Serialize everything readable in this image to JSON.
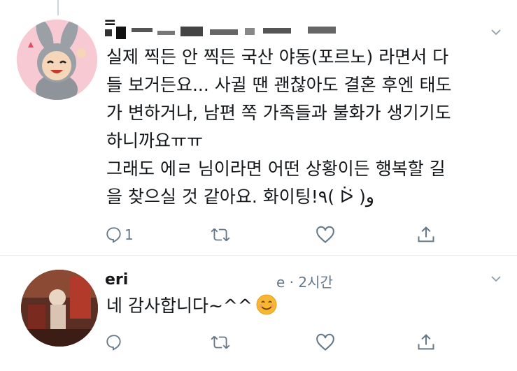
{
  "tweets": [
    {
      "display_name": "=",
      "text_lines": [
        "실제 찍든 안 찍든 국산 야동(포르노) 라면서 다",
        "들 보거든요... 사귈 땐 괜찮아도 결혼 후엔 태도",
        "가 변하거나, 남편 쪽 가족들과 불화가 생기기도",
        "하니까요ㅠㅠ",
        "그래도 에ㄹ       님이라면 어떤 상황이든 행복할 길",
        "을 찾으실 것 같아요. 화이팅!٩( ᐖ )و"
      ],
      "reply_count": "1",
      "icons": [
        "reply-icon",
        "retweet-icon",
        "like-icon",
        "share-icon",
        "chevron-down-icon"
      ]
    },
    {
      "display_name": "eri",
      "handle_time": "e · 2시간",
      "text": "네 감사합니다~^^",
      "reply_count": "",
      "icons": [
        "reply-icon",
        "retweet-icon",
        "like-icon",
        "share-icon",
        "chevron-down-icon",
        "smiling-face-emoji"
      ]
    }
  ],
  "colors": {
    "text": "#14171a",
    "secondary": "#657786",
    "divider": "#e6ecf0",
    "emoji": "#f7b731"
  }
}
